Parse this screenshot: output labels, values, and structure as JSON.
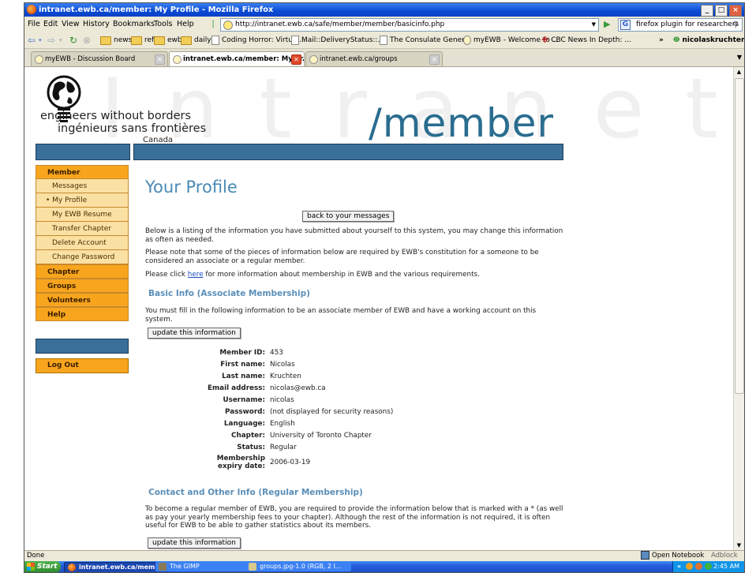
{
  "window": {
    "title": "intranet.ewb.ca/member: My Profile - Mozilla Firefox",
    "controls": [
      "_",
      "□",
      "×"
    ]
  },
  "menu": [
    "File",
    "Edit",
    "View",
    "History",
    "Bookmarks",
    "Tools",
    "Help"
  ],
  "address": {
    "url": "http://intranet.ewb.ca/safe/member/member/basicinfo.php"
  },
  "search": {
    "engine": "G",
    "value": "firefox plugin for researchers"
  },
  "bookmarks": [
    {
      "label": "news",
      "kind": "folder"
    },
    {
      "label": "ref",
      "kind": "folder"
    },
    {
      "label": "ewb",
      "kind": "folder"
    },
    {
      "label": "daily",
      "kind": "folder"
    },
    {
      "label": "Coding Horror: Virtual...",
      "kind": "page"
    },
    {
      "label": "Mail::DeliveryStatus::...",
      "kind": "page"
    },
    {
      "label": "The Consulate Gener...",
      "kind": "page"
    },
    {
      "label": "myEWB - Welcome to ...",
      "kind": "page"
    },
    {
      "label": "CBC News In Depth: ...",
      "kind": "page"
    }
  ],
  "bookmarks_overflow": "»",
  "user_menu": "nicolaskruchten",
  "tabs": [
    {
      "label": "myEWB - Discussion Board",
      "active": false
    },
    {
      "label": "intranet.ewb.ca/member: My Pr...",
      "active": true
    },
    {
      "label": "intranet.ewb.ca/groups",
      "active": false
    }
  ],
  "header": {
    "bg_word": "Intranet",
    "logo_en": "engineers without borders",
    "logo_fr": "ingénieurs sans frontières",
    "logo_country": "Canada",
    "section": "/member"
  },
  "sidebar": {
    "member": {
      "label": "Member",
      "items": [
        {
          "label": "Messages",
          "current": false
        },
        {
          "label": "• My Profile",
          "current": true
        },
        {
          "label": "My EWB Resume",
          "current": false
        },
        {
          "label": "Transfer Chapter",
          "current": false
        },
        {
          "label": "Delete Account",
          "current": false
        },
        {
          "label": "Change Password",
          "current": false
        }
      ]
    },
    "sections": [
      "Chapter",
      "Groups",
      "Volunteers",
      "Help"
    ],
    "logout": "Log Out"
  },
  "page": {
    "title": "Your Profile",
    "back_button": "back to your messages",
    "intro1": "Below is a listing of the information you have submitted about yourself to this system, you may change this information as often as needed.",
    "intro2": "Please note that some of the pieces of information below are required by EWB's constitution for a someone to be considered an associate or a regular member.",
    "intro3_pre": "Please click ",
    "intro3_link": "here",
    "intro3_post": " for more information about membership in EWB and the various requirements.",
    "basic": {
      "heading": "Basic Info (Associate Membership)",
      "desc": "You must fill in the following information to be an associate member of EWB and have a working account on this system.",
      "update_button": "update this information",
      "fields": [
        {
          "label": "Member ID:",
          "value": "453"
        },
        {
          "label": "First name:",
          "value": "Nicolas"
        },
        {
          "label": "Last name:",
          "value": "Kruchten"
        },
        {
          "label": "Email address:",
          "value": "nicolas@ewb.ca"
        },
        {
          "label": "Username:",
          "value": "nicolas"
        },
        {
          "label": "Password:",
          "value": "(not displayed for security reasons)"
        },
        {
          "label": "Language:",
          "value": "English"
        },
        {
          "label": "Chapter:",
          "value": "University of Toronto Chapter"
        },
        {
          "label": "Status:",
          "value": "Regular"
        },
        {
          "label": "Membership expiry date:",
          "value": "2006-03-19"
        }
      ]
    },
    "contact": {
      "heading": "Contact and Other Info (Regular Membership)",
      "desc": "To become a regular member of EWB, you are required to provide the information below that is marked with a * (as well as pay your yearly membership fees to your chapter). Although the rest of the information is not required, it is often useful for EWB to be able to gather statistics about its members.",
      "update_button": "update this information"
    }
  },
  "status": {
    "text": "Done",
    "notebook": "Open Notebook",
    "adblock": "Adblock"
  },
  "taskbar": {
    "start": "Start",
    "tasks": [
      "intranet.ewb.ca/mem...",
      "The GIMP",
      "groups.jpg-1.0 (RGB, 2 l..."
    ],
    "tray_chevron": "«",
    "clock": "2:45 AM"
  },
  "colors": {
    "accent_blue": "#3a6f9a",
    "nav_orange": "#f8a51e",
    "heading_blue": "#4a8ab5"
  }
}
